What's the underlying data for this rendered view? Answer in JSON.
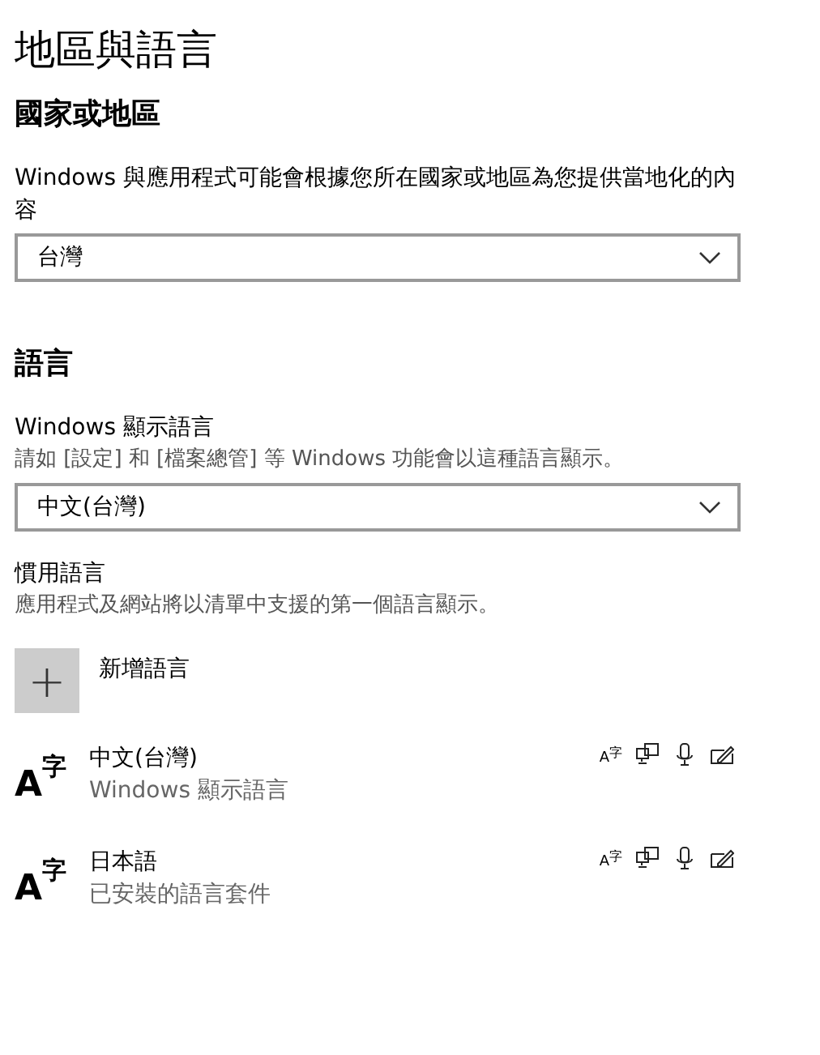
{
  "title": "地區與語言",
  "region": {
    "heading": "國家或地區",
    "description": "Windows 與應用程式可能會根據您所在國家或地區為您提供當地化的內容",
    "dropdown": {
      "value": "台灣"
    }
  },
  "language": {
    "heading": "語言",
    "display_label": "Windows 顯示語言",
    "display_description": "請如 [設定] 和 [檔案總管] 等 Windows 功能會以這種語言顯示。",
    "dropdown": {
      "value": "中文(台灣)"
    },
    "preferred_label": "慣用語言",
    "preferred_description": "應用程式及網站將以清單中支援的第一個語言顯示。",
    "add_button": {
      "icon": "+",
      "label": "新增語言"
    },
    "items": [
      {
        "glyph_base": "A",
        "glyph_raised": "字",
        "name": "中文(台灣)",
        "detail": "Windows 顯示語言",
        "features": [
          {
            "kind": "language-pack",
            "base": "A",
            "raised": "字"
          },
          {
            "kind": "display"
          },
          {
            "kind": "speech"
          },
          {
            "kind": "handwriting"
          }
        ]
      },
      {
        "glyph_base": "A",
        "glyph_raised": "字",
        "name": "日本語",
        "detail": "已安裝的語言套件",
        "features": [
          {
            "kind": "language-pack",
            "base": "A",
            "raised": "字"
          },
          {
            "kind": "display"
          },
          {
            "kind": "speech"
          },
          {
            "kind": "handwriting"
          }
        ]
      }
    ]
  }
}
